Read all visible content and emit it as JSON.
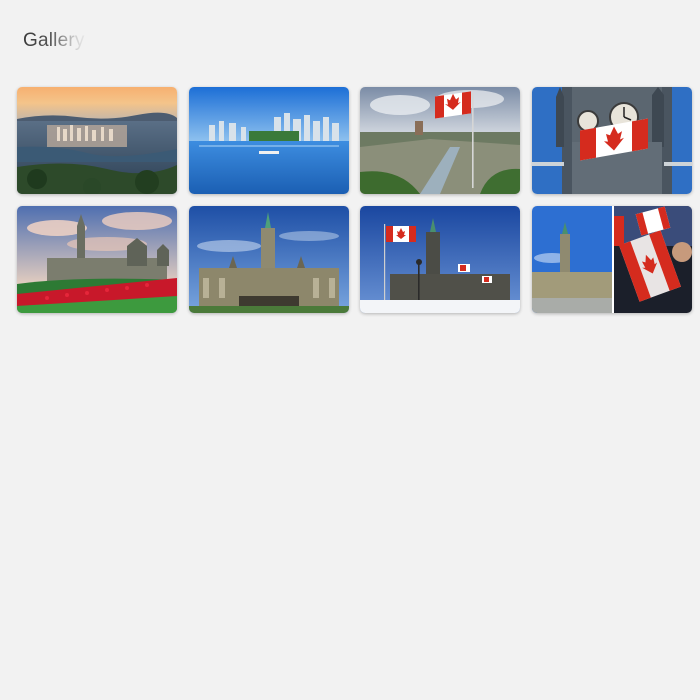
{
  "header": {
    "title": "Gallery"
  },
  "gallery": {
    "items": [
      {
        "name": "vancouver-harbor-sunset-photo"
      },
      {
        "name": "vancouver-skyline-water-photo"
      },
      {
        "name": "quebec-city-flag-photo"
      },
      {
        "name": "peace-tower-clock-flag-photo"
      },
      {
        "name": "parliament-tulips-photo"
      },
      {
        "name": "parliament-centre-block-photo"
      },
      {
        "name": "parliament-winter-flags-photo"
      },
      {
        "name": "parliament-and-flag-collage-photo"
      }
    ]
  },
  "colors": {
    "background": "#f2f2f2",
    "flag_red": "#d52b1e",
    "sky_blue": "#2f6fc4"
  }
}
